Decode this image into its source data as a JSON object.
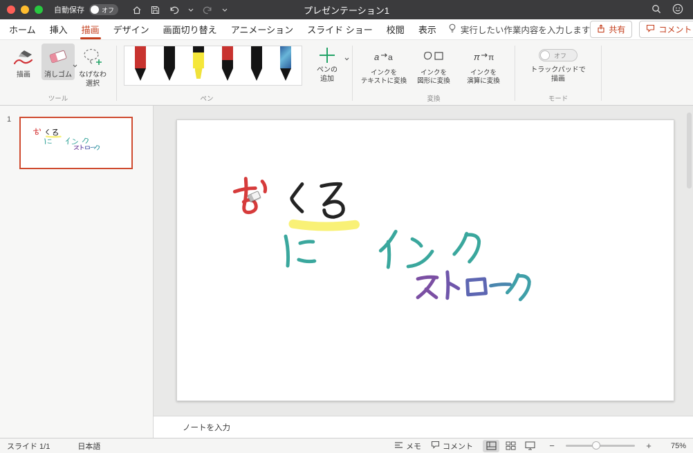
{
  "colors": {
    "accent_red": "#c43e1c",
    "selection_border": "#cf4a2e",
    "ink_red": "#d63b3b",
    "ink_black": "#232323",
    "ink_teal": "#3aa79d",
    "ink_purple": "#7b4fa3",
    "ink_violet": "#6f56ab",
    "ink_indigo": "#5d66b2",
    "ink_blue": "#4a86ae",
    "ink_teal2": "#3f9fa8",
    "ink_highlight": "#f8ee54"
  },
  "titlebar": {
    "autosave_label": "自動保存",
    "autosave_state": "オフ",
    "title": "プレゼンテーション1"
  },
  "tabs": [
    {
      "label": "ホーム"
    },
    {
      "label": "挿入"
    },
    {
      "label": "描画",
      "active": true
    },
    {
      "label": "デザイン"
    },
    {
      "label": "画面切り替え"
    },
    {
      "label": "アニメーション"
    },
    {
      "label": "スライド ショー"
    },
    {
      "label": "校閲"
    },
    {
      "label": "表示"
    }
  ],
  "tellme": "実行したい作業内容を入力します",
  "actions": {
    "share": "共有",
    "comments": "コメント"
  },
  "ribbon": {
    "tools": {
      "label": "ツール",
      "draw": "描画",
      "eraser": "消しゴム",
      "lasso": "なげなわ選択"
    },
    "pens": {
      "label": "ペン",
      "add_line1": "ペンの",
      "add_line2": "追加",
      "items": [
        {
          "body": "#c8332f",
          "tip": "#141414",
          "type": "pen"
        },
        {
          "body": "#141414",
          "tip": "#141414",
          "type": "pen"
        },
        {
          "body": "#f5e73a",
          "tip": "#f0e23a",
          "type": "highlighter"
        },
        {
          "body": "linear-gradient(#c8332f 0 20px,#141414 20px)",
          "tip": "#141414",
          "type": "pen"
        },
        {
          "body": "#141414",
          "tip": "#141414",
          "type": "pen"
        },
        {
          "body": "linear-gradient(135deg,#2e5f9e,#69b6d9 45%,#2e5f9e)",
          "tip": "#141414",
          "type": "pen"
        }
      ]
    },
    "convert": {
      "label": "変換",
      "items": [
        {
          "line1": "インクを",
          "line2": "テキストに変換"
        },
        {
          "line1": "インクを",
          "line2": "図形に変換"
        },
        {
          "line1": "インクを",
          "line2": "演算に変換"
        }
      ]
    },
    "mode": {
      "label": "モード",
      "toggle_state": "オフ",
      "line1": "トラックパッドで",
      "line2": "描画"
    }
  },
  "slides_panel": {
    "slide_number": "1"
  },
  "ink": {
    "characters": [
      "お",
      "くろ",
      "に",
      "インク",
      "ストローク"
    ]
  },
  "notes": {
    "placeholder": "ノートを入力"
  },
  "statusbar": {
    "slide_counter": "スライド 1/1",
    "language": "日本語",
    "memo": "メモ",
    "comments": "コメント",
    "zoom_out": "−",
    "zoom_in": "+",
    "zoom_percent": "75%"
  }
}
